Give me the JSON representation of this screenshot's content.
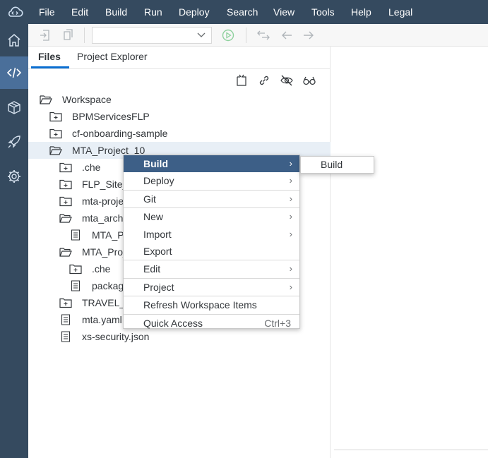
{
  "menubar": {
    "items": [
      "File",
      "Edit",
      "Build",
      "Run",
      "Deploy",
      "Search",
      "View",
      "Tools",
      "Help",
      "Legal"
    ],
    "logo_icon": "cloud-code-icon",
    "background": "#354a5f"
  },
  "activitybar": {
    "items": [
      {
        "icon": "home-icon",
        "active": false
      },
      {
        "icon": "code-icon",
        "active": true
      },
      {
        "icon": "packages-icon",
        "active": false
      },
      {
        "icon": "rocket-icon",
        "active": false
      },
      {
        "icon": "gear-icon",
        "active": false
      }
    ],
    "active_color": "#4a6f9a"
  },
  "toolbar": {
    "icons": [
      "import-icon",
      "export-icon",
      "run-icon",
      "compare-icon",
      "back-icon",
      "forward-icon"
    ],
    "run_config_value": ""
  },
  "files_panel": {
    "tabs": [
      "Files",
      "Project Explorer"
    ],
    "active_tab": "Files",
    "tools": [
      "new-file-icon",
      "link-icon",
      "hide-icon",
      "search-icon"
    ],
    "tree": [
      {
        "label": "Workspace",
        "type": "folder-open",
        "level": 0
      },
      {
        "label": "BPMServicesFLP",
        "type": "project",
        "level": 1
      },
      {
        "label": "cf-onboarding-sample",
        "type": "project",
        "level": 1
      },
      {
        "label": "MTA_Project_10",
        "type": "folder-open",
        "level": 1,
        "selected": true
      },
      {
        "label": ".che",
        "type": "project",
        "level": 2
      },
      {
        "label": "FLP_Site_",
        "type": "project",
        "level": 2
      },
      {
        "label": "mta-proje",
        "type": "project",
        "level": 2
      },
      {
        "label": "mta_arch",
        "type": "folder-open",
        "level": 2
      },
      {
        "label": "MTA_P",
        "type": "file",
        "level": 3
      },
      {
        "label": "MTA_Proj",
        "type": "folder-open",
        "level": 2
      },
      {
        "label": ".che",
        "type": "project",
        "level": 3
      },
      {
        "label": "packag",
        "type": "file",
        "level": 3
      },
      {
        "label": "TRAVEL_",
        "type": "project",
        "level": 2
      },
      {
        "label": "mta.yaml",
        "type": "file",
        "level": 2
      },
      {
        "label": "xs-security.json",
        "type": "file",
        "level": 2
      }
    ]
  },
  "context_menu": {
    "items": [
      {
        "label": "Build",
        "arrow": "›",
        "active": true
      },
      {
        "label": "Deploy",
        "arrow": "›"
      },
      {
        "sep": true
      },
      {
        "label": "Git",
        "arrow": "›"
      },
      {
        "sep": true
      },
      {
        "label": "New",
        "arrow": "›"
      },
      {
        "label": "Import",
        "arrow": "›"
      },
      {
        "label": "Export"
      },
      {
        "sep": true
      },
      {
        "label": "Edit",
        "arrow": "›"
      },
      {
        "sep": true
      },
      {
        "label": "Project",
        "arrow": "›"
      },
      {
        "sep": true
      },
      {
        "label": "Refresh Workspace Items"
      },
      {
        "sep": true
      },
      {
        "label": "Quick Access",
        "shortcut": "Ctrl+3"
      }
    ],
    "active_color": "#3d5f87"
  },
  "submenu": {
    "items": [
      "Build"
    ]
  }
}
